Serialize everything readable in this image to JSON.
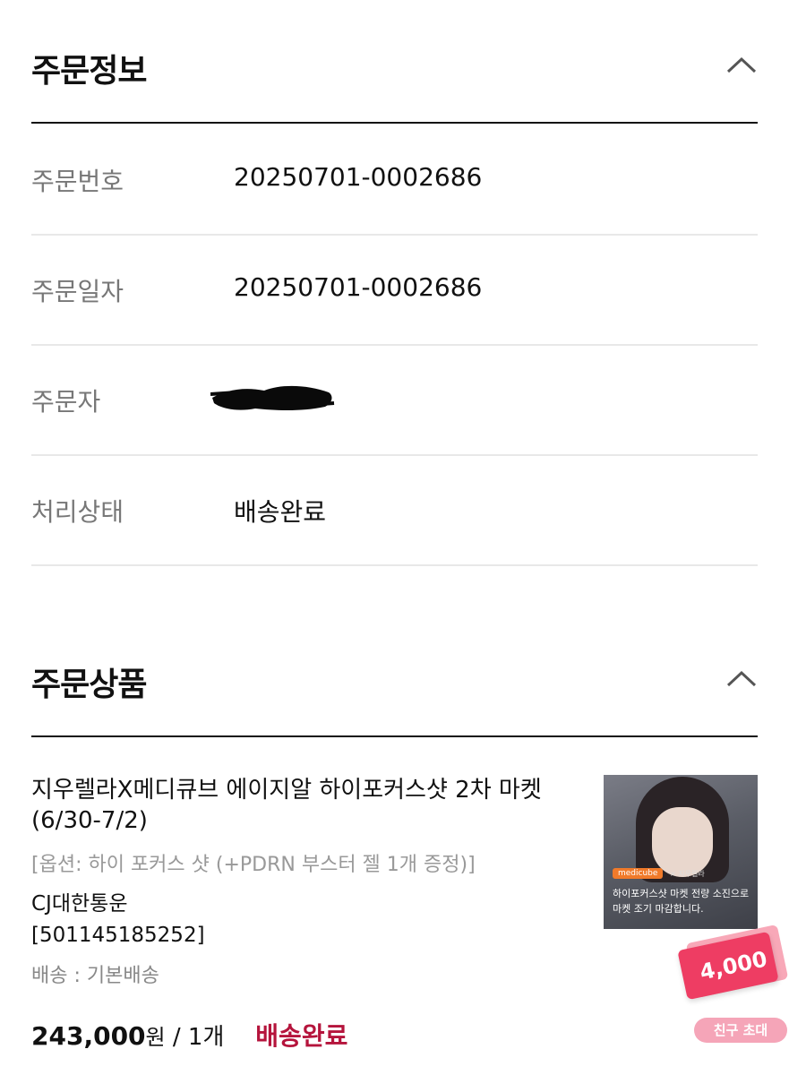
{
  "order_info": {
    "title": "주문정보",
    "rows": [
      {
        "label": "주문번호",
        "value": "20250701-0002686"
      },
      {
        "label": "주문일자",
        "value": "20250701-0002686"
      },
      {
        "label": "주문자",
        "value": ""
      },
      {
        "label": "처리상태",
        "value": "배송완료"
      }
    ]
  },
  "order_products": {
    "title": "주문상품",
    "item": {
      "name": "지우렐라X메디큐브 에이지알 하이포커스샷 2차 마켓 (6/30-7/2)",
      "option": "[옵션: 하이 포커스 샷 (+PDRN 부스터 젤 1개 증정)]",
      "courier": "CJ대한통운",
      "tracking": "[501145185252]",
      "shipping": "배송 : 기본배송",
      "price": "243,000",
      "currency": "원",
      "separator": " / ",
      "quantity": "1개",
      "status": "배송완료",
      "thumbnail": {
        "brand": "medicube",
        "collab": "× 지우렐라",
        "caption": "하이포커스샷 마켓 전량 소진으로 마켓 조기 마감합니다."
      }
    }
  },
  "floating": {
    "coupon_amount": "4,000",
    "invite_label": "친구 초대"
  },
  "colors": {
    "status_accent": "#b5143c",
    "coupon": "#ee3d63",
    "invite": "#f5a5b8"
  }
}
